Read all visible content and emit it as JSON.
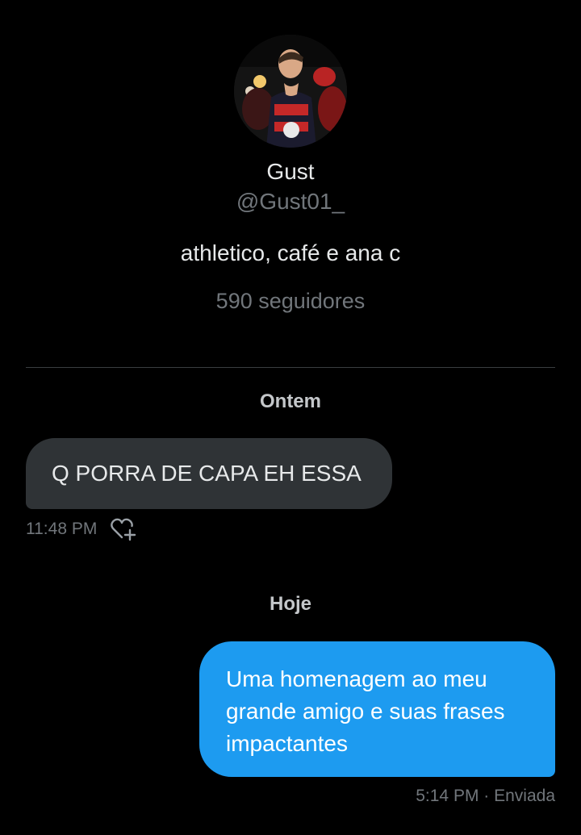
{
  "profile": {
    "avatar_alt": "profile photo",
    "name": "Gust",
    "handle": "@Gust01_",
    "bio": "athletico, café e ana c",
    "followers": "590 seguidores"
  },
  "conversation": {
    "days": [
      {
        "label": "Ontem",
        "messages": [
          {
            "direction": "incoming",
            "text": "Q PORRA DE CAPA EH ESSA",
            "time": "11:48 PM",
            "reaction_icon": "add-reaction-heart-icon"
          }
        ]
      },
      {
        "label": "Hoje",
        "messages": [
          {
            "direction": "outgoing",
            "text": "Uma homenagem ao meu grande amigo e suas frases impactantes",
            "status": "5:14 PM · Enviada"
          }
        ]
      }
    ]
  },
  "colors": {
    "background": "#000000",
    "incoming_bubble": "#2f3336",
    "outgoing_bubble": "#1d9bf0",
    "primary_text": "#e7e9ea",
    "secondary_text": "#71767b"
  }
}
